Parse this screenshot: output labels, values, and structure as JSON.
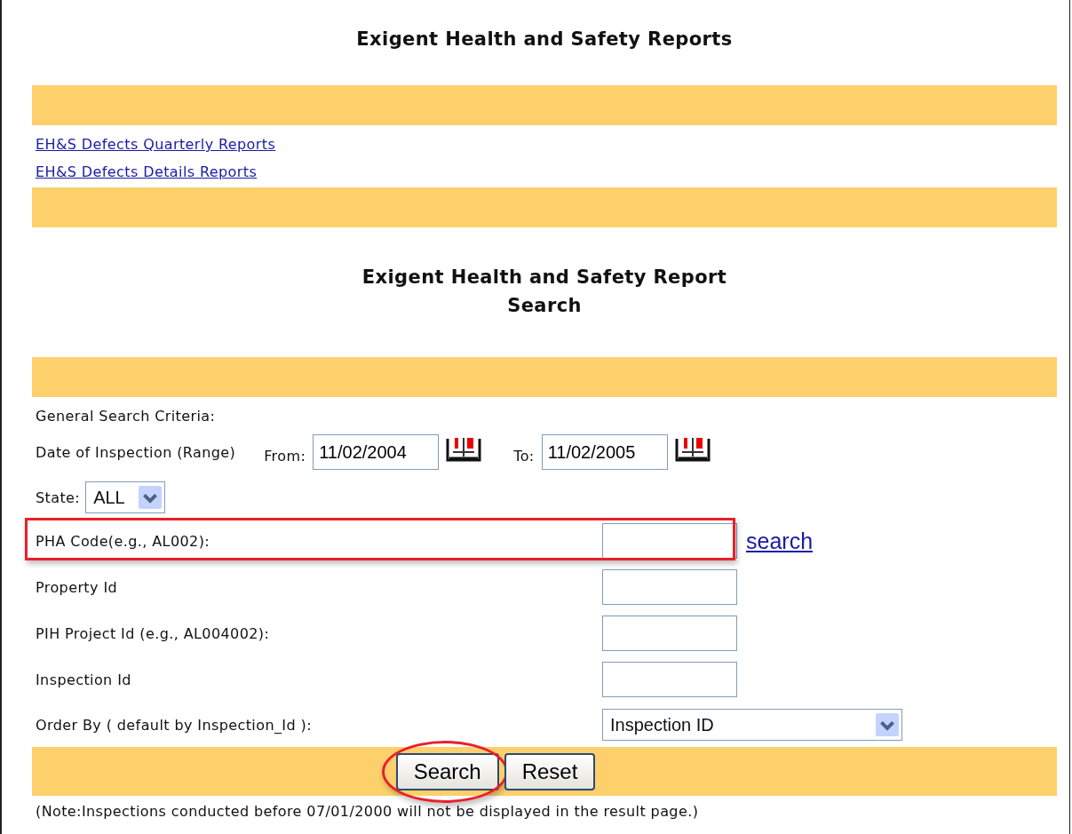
{
  "title": "Exigent Health and Safety Reports",
  "report_links": [
    "EH&S Defects Quarterly Reports",
    "EH&S Defects Details Reports"
  ],
  "form_heading": [
    "Exigent Health and Safety Report",
    "Search"
  ],
  "section_label": "General Search Criteria:",
  "date_range": {
    "label": "Date of Inspection (Range)",
    "from_label": "From:",
    "from_value": "11/02/2004",
    "to_label": "To:",
    "to_value": "11/02/2005"
  },
  "state": {
    "label": "State:",
    "value": "ALL"
  },
  "fields": [
    {
      "label": "PHA Code(e.g., AL002):",
      "link": "search",
      "highlighted": true
    },
    {
      "label": "Property Id",
      "highlighted": false
    },
    {
      "label": "PIH Project Id (e.g., AL004002):",
      "highlighted": false
    },
    {
      "label": "Inspection Id",
      "highlighted": false
    }
  ],
  "order_by": {
    "label": "Order By ( default by Inspection_Id ):",
    "value": "Inspection ID"
  },
  "buttons": [
    {
      "label": "Search",
      "highlighted": true
    },
    {
      "label": "Reset",
      "highlighted": false
    }
  ],
  "note": "(Note:Inspections conducted before 07/01/2000 will not be displayed in the result page.)"
}
